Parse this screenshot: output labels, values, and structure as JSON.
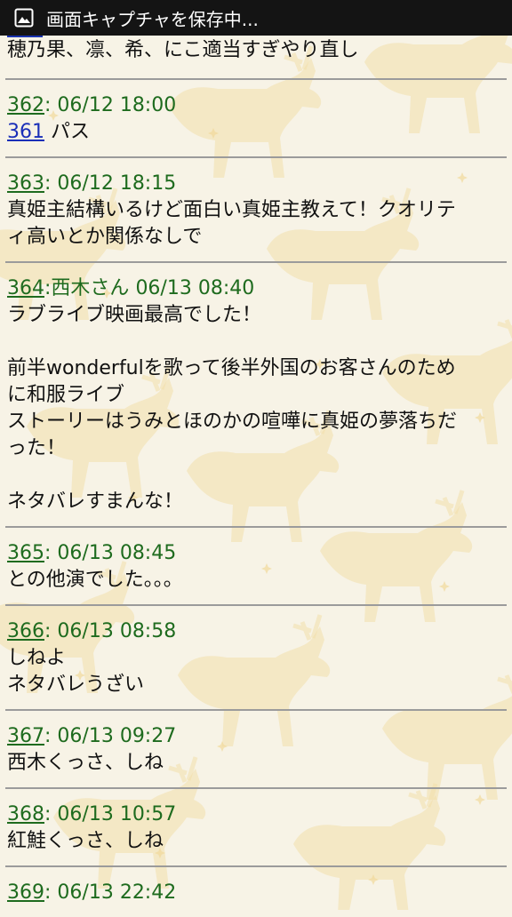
{
  "statusbar": {
    "icon": "image-icon",
    "title": "画面キャプチャを保存中..."
  },
  "first_fragment": {
    "text": "穂乃果、凛、希、にこ適当すぎやり直し"
  },
  "posts": [
    {
      "number": "362",
      "author": "",
      "date": "06/12 18:00",
      "reply_to": "361",
      "body": "パス"
    },
    {
      "number": "363",
      "author": "",
      "date": "06/12 18:15",
      "reply_to": "",
      "body": "真姫主結構いるけど面白い真姫主教えて！クオリテ\nィ高いとか関係なしで"
    },
    {
      "number": "364",
      "author": "西木さん",
      "date": "06/13 08:40",
      "reply_to": "",
      "body": "ラブライブ映画最高でした！\n\n前半wonderfulを歌って後半外国のお客さんのため\nに和服ライブ\nストーリーはうみとほのかの喧嘩に真姫の夢落ちだ\nった！\n\nネタバレすまんな！"
    },
    {
      "number": "365",
      "author": "",
      "date": "06/13 08:45",
      "reply_to": "",
      "body": "との他演でした。。。"
    },
    {
      "number": "366",
      "author": "",
      "date": "06/13 08:58",
      "reply_to": "",
      "body": "しねよ\nネタバレうざい"
    },
    {
      "number": "367",
      "author": "",
      "date": "06/13 09:27",
      "reply_to": "",
      "body": "西木くっさ、しね"
    },
    {
      "number": "368",
      "author": "",
      "date": "06/13 10:57",
      "reply_to": "",
      "body": "紅鮭くっさ、しね"
    },
    {
      "number": "369",
      "author": "",
      "date": "06/13 22:42",
      "reply_to": "",
      "body": ""
    }
  ]
}
